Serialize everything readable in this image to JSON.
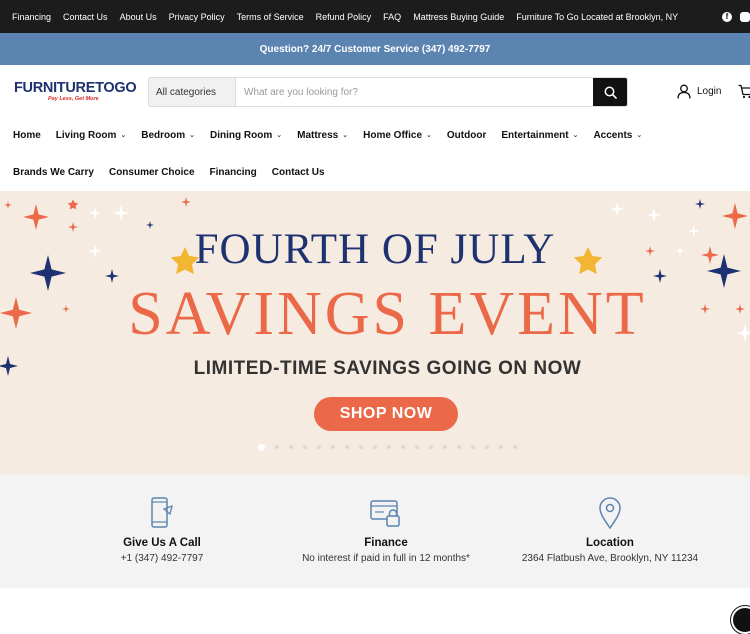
{
  "topbar": {
    "links": [
      "Financing",
      "Contact Us",
      "About Us",
      "Privacy Policy",
      "Terms of Service",
      "Refund Policy",
      "FAQ",
      "Mattress Buying Guide",
      "Furniture To Go Located at Brooklyn, NY"
    ],
    "social": [
      "facebook-icon",
      "instagram-icon"
    ]
  },
  "promo": {
    "text": "Question? 24/7 Customer Service (347) 492-7797"
  },
  "header": {
    "logo_main": "FURNITURETOGO",
    "logo_tagline": "Pay Less, Get More",
    "category": "All categories",
    "search_placeholder": "What are you looking for?",
    "login": "Login"
  },
  "nav": {
    "row1": [
      {
        "label": "Home",
        "dropdown": false
      },
      {
        "label": "Living Room",
        "dropdown": true
      },
      {
        "label": "Bedroom",
        "dropdown": true
      },
      {
        "label": "Dining Room",
        "dropdown": true
      },
      {
        "label": "Mattress",
        "dropdown": true
      },
      {
        "label": "Home Office",
        "dropdown": true
      },
      {
        "label": "Outdoor",
        "dropdown": false
      },
      {
        "label": "Entertainment",
        "dropdown": true
      },
      {
        "label": "Accents",
        "dropdown": true
      }
    ],
    "row2": [
      "Brands We Carry",
      "Consumer Choice",
      "Financing",
      "Contact Us"
    ]
  },
  "hero": {
    "title1": "FOURTH OF JULY",
    "title2": "SAVINGS EVENT",
    "subtitle": "LIMITED-TIME SAVINGS GOING ON NOW",
    "cta": "SHOP NOW",
    "slide_count": 19,
    "active_slide": 1,
    "colors": {
      "navy": "#1e3170",
      "coral": "#eb6848",
      "background": "#f6ebe1",
      "gold": "#f2b632"
    }
  },
  "features": [
    {
      "icon": "phone-icon",
      "title": "Give Us A Call",
      "detail": "+1 (347) 492-7797"
    },
    {
      "icon": "credit-card-lock-icon",
      "title": "Finance",
      "detail": "No interest if paid in full in 12 months*"
    },
    {
      "icon": "location-pin-icon",
      "title": "Location",
      "detail": "2364 Flatbush Ave, Brooklyn, NY 11234"
    }
  ],
  "colors": {
    "topbar": "#1c1c1c",
    "promo": "#5b84b1",
    "accent": "#eb6848",
    "icon": "#5b84b1"
  }
}
